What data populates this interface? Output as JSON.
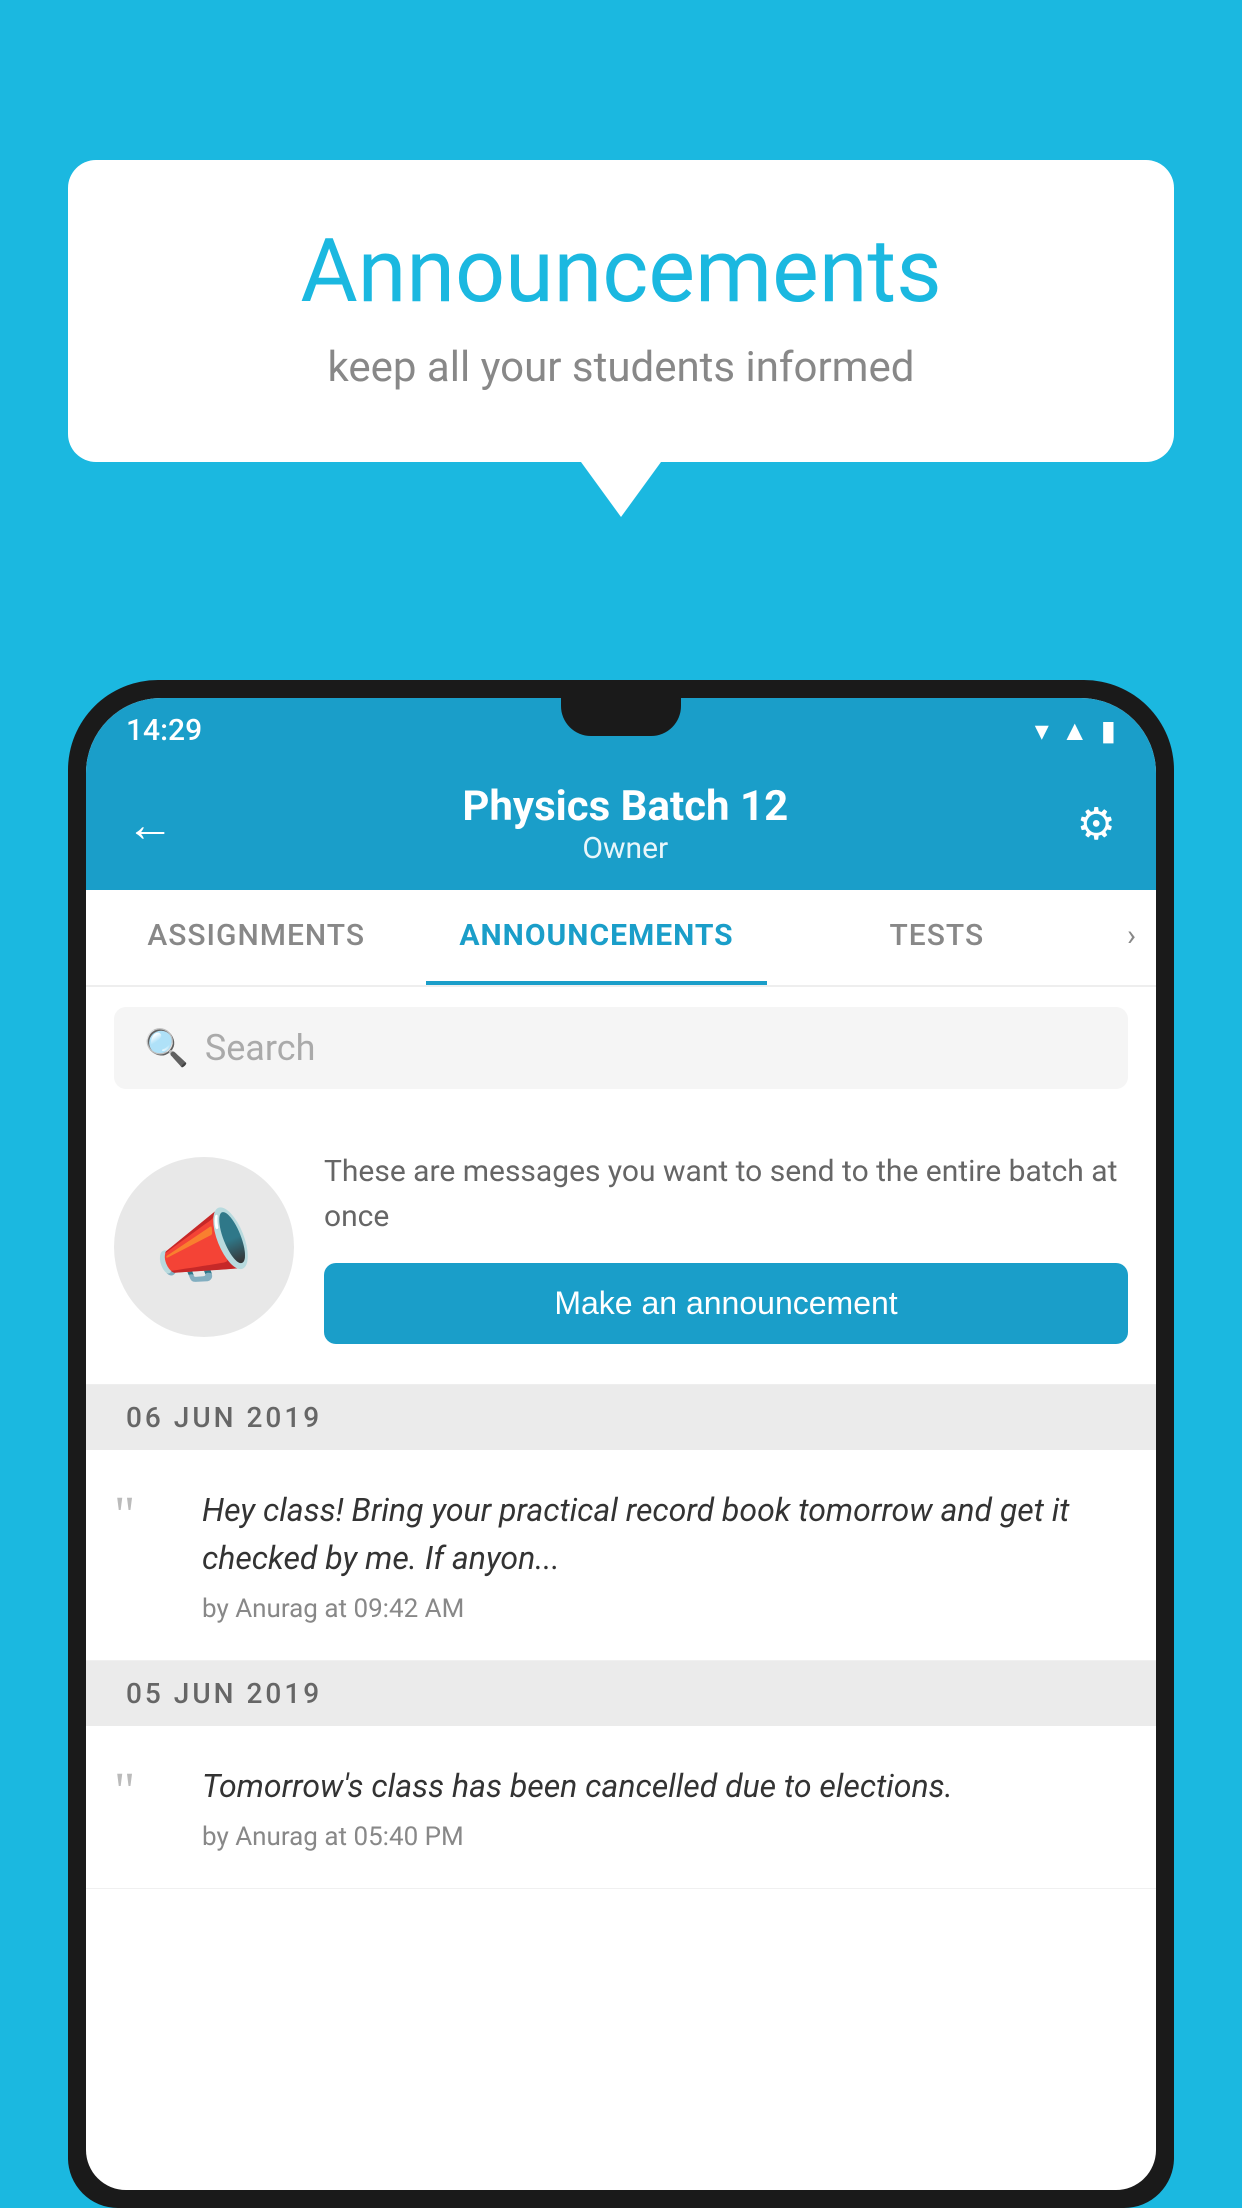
{
  "background_color": "#1BB8E0",
  "speech_bubble": {
    "title": "Announcements",
    "subtitle": "keep all your students informed"
  },
  "phone": {
    "status_bar": {
      "time": "14:29"
    },
    "header": {
      "title": "Physics Batch 12",
      "subtitle": "Owner",
      "back_label": "←",
      "settings_label": "⚙"
    },
    "tabs": [
      {
        "label": "ASSIGNMENTS",
        "active": false
      },
      {
        "label": "ANNOUNCEMENTS",
        "active": true
      },
      {
        "label": "TESTS",
        "active": false
      }
    ],
    "tabs_more": "›",
    "search": {
      "placeholder": "Search"
    },
    "promo_card": {
      "description": "These are messages you want to send to the entire batch at once",
      "button_label": "Make an announcement"
    },
    "announcements": [
      {
        "date": "06  JUN  2019",
        "text": "Hey class! Bring your practical record book tomorrow and get it checked by me. If anyon...",
        "meta": "by Anurag at 09:42 AM"
      },
      {
        "date": "05  JUN  2019",
        "text": "Tomorrow's class has been cancelled due to elections.",
        "meta": "by Anurag at 05:40 PM"
      }
    ]
  }
}
